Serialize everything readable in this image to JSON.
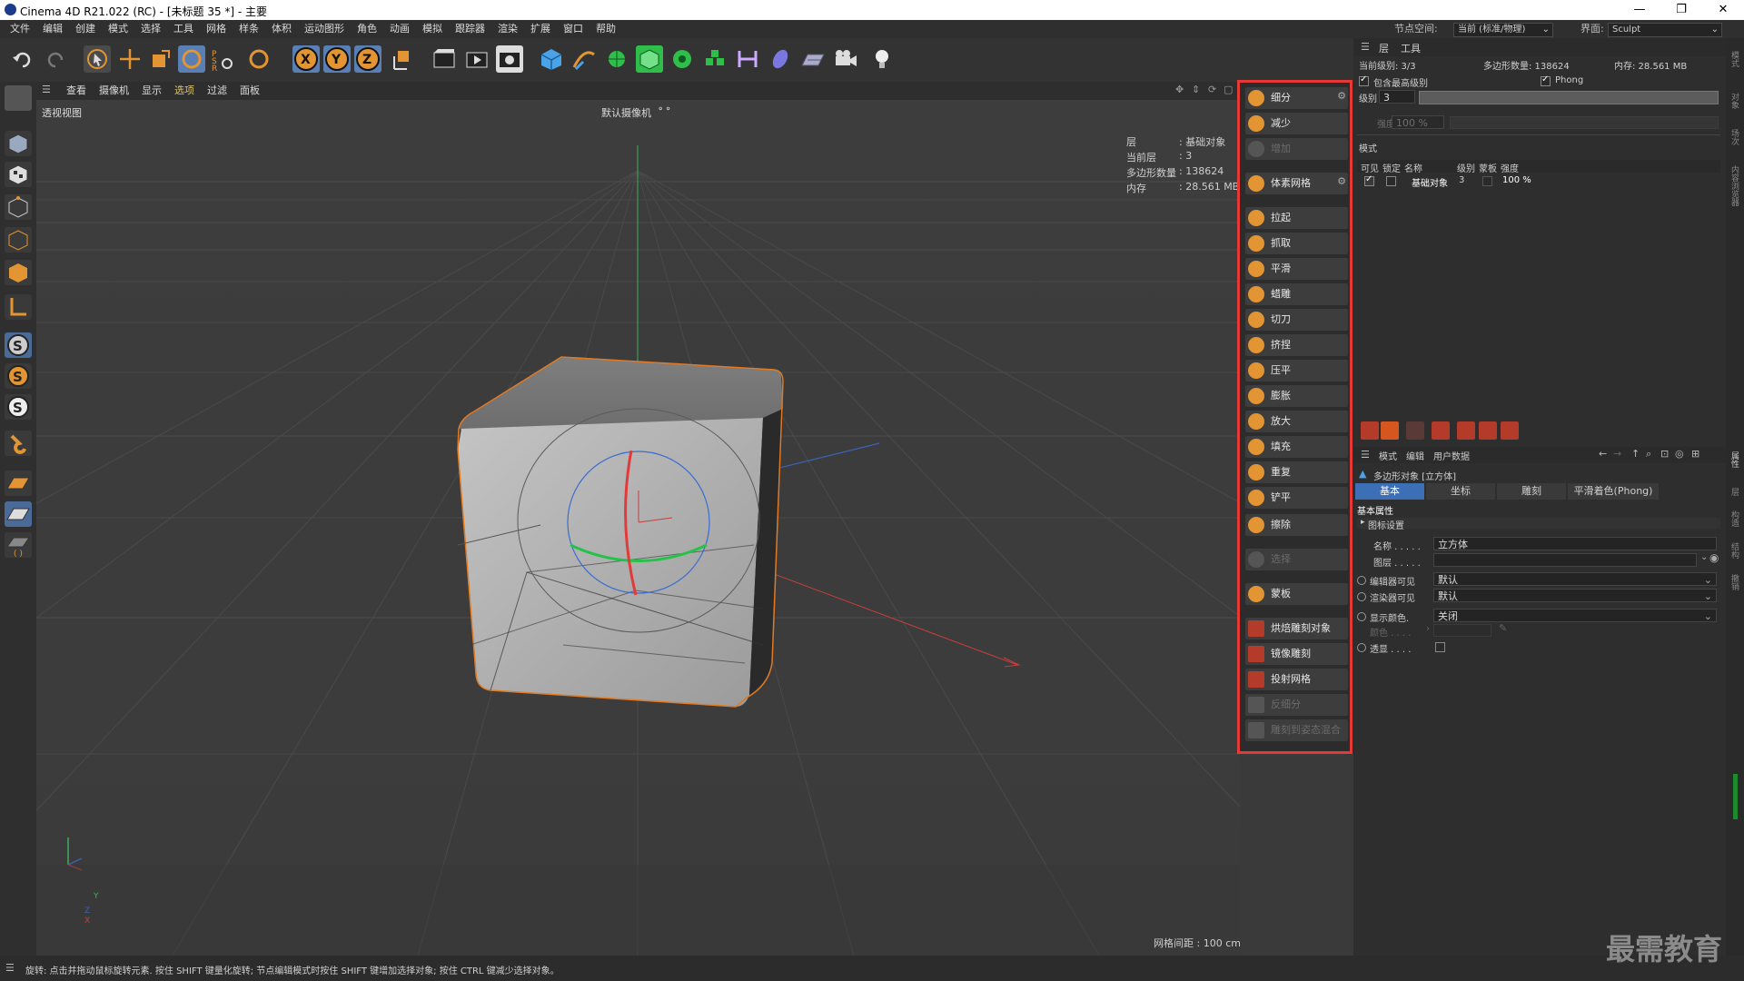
{
  "window": {
    "title": "Cinema 4D R21.022 (RC) - [未标题 35 *] - 主要",
    "controls": [
      "—",
      "❐",
      "✕"
    ]
  },
  "menubar": {
    "items": [
      "文件",
      "编辑",
      "创建",
      "模式",
      "选择",
      "工具",
      "网格",
      "样条",
      "体积",
      "运动图形",
      "角色",
      "动画",
      "模拟",
      "跟踪器",
      "渲染",
      "扩展",
      "窗口",
      "帮助"
    ],
    "node_space_label": "节点空间:",
    "node_space_value": "当前 (标准/物理)",
    "layout_label": "界面:",
    "layout_value": "Sculpt"
  },
  "viewport": {
    "menu": [
      "查看",
      "摄像机",
      "显示",
      "选项",
      "过滤",
      "面板"
    ],
    "view_name": "透视视图",
    "camera_label": "默认摄像机",
    "camera_icon": "camera-icon",
    "hud": {
      "layer_label": "层",
      "layer_value": ": 基础对象",
      "current_level_label": "当前层",
      "current_level_value": ": 3",
      "poly_count_label": "多边形数量",
      "poly_count_value": ": 138624",
      "memory_label": "内存",
      "memory_value": ": 28.561 MB"
    },
    "grid_spacing": "网格间距 : 100 cm",
    "axis_labels": {
      "y": "Y",
      "z": "Z",
      "x": "X"
    }
  },
  "sculpt_palette": {
    "items": [
      {
        "label": "细分",
        "enabled": true,
        "gear": true
      },
      {
        "label": "减少",
        "enabled": true
      },
      {
        "label": "增加",
        "enabled": false
      },
      {
        "label": "体素网格",
        "enabled": true,
        "gear": true
      },
      {
        "label": "拉起",
        "enabled": true
      },
      {
        "label": "抓取",
        "enabled": true
      },
      {
        "label": "平滑",
        "enabled": true
      },
      {
        "label": "蜡雕",
        "enabled": true
      },
      {
        "label": "切刀",
        "enabled": true
      },
      {
        "label": "挤捏",
        "enabled": true
      },
      {
        "label": "压平",
        "enabled": true
      },
      {
        "label": "膨胀",
        "enabled": true
      },
      {
        "label": "放大",
        "enabled": true
      },
      {
        "label": "填充",
        "enabled": true
      },
      {
        "label": "重复",
        "enabled": true
      },
      {
        "label": "铲平",
        "enabled": true
      },
      {
        "label": "擦除",
        "enabled": true
      },
      {
        "label": "选择",
        "enabled": false
      },
      {
        "label": "蒙板",
        "enabled": true
      },
      {
        "label": "烘焙雕刻对象",
        "enabled": true
      },
      {
        "label": "镜像雕刻",
        "enabled": true
      },
      {
        "label": "投射网格",
        "enabled": true
      },
      {
        "label": "反细分",
        "enabled": false
      },
      {
        "label": "雕刻到姿态混合",
        "enabled": false
      }
    ]
  },
  "layers_panel": {
    "tabs": [
      "层",
      "工具"
    ],
    "current_level": "当前级别: 3/3",
    "poly_count": "多边形数量: 138624",
    "memory": "内存: 28.561 MB",
    "include_highest": "包含最高级别",
    "phong": "Phong",
    "level_label": "级别",
    "level_value": "3",
    "strength_label": "强度",
    "strength_value": "100 %",
    "mode_label": "模式",
    "columns": [
      "可见",
      "锁定",
      "名称",
      "级别",
      "蒙板",
      "强度"
    ],
    "rows": [
      {
        "name": "基础对象",
        "level": "3",
        "strength": "100 %"
      }
    ]
  },
  "attributes_panel": {
    "menu": [
      "模式",
      "编辑",
      "用户数据"
    ],
    "object_title": "多边形对象 [立方体]",
    "tabs": [
      "基本",
      "坐标",
      "雕刻",
      "平滑着色(Phong)"
    ],
    "section": "基本属性",
    "subsection": "图标设置",
    "name_label": "名称 . . . . .",
    "name_value": "立方体",
    "layer_label": "图层 . . . . .",
    "editor_visible_label": "编辑器可见",
    "editor_visible_value": "默认",
    "render_visible_label": "渲染器可见",
    "render_visible_value": "默认",
    "display_color_label": "显示颜色.",
    "display_color_value": "关闭",
    "color_label": "颜色 . . . .",
    "xray_label": "透显 . . . ."
  },
  "right_strip_tabs": [
    "模式",
    "对象",
    "场次",
    "内容浏览器",
    "属性",
    "层",
    "构造",
    "结构",
    "撤销"
  ],
  "statusbar": {
    "text": "旋转: 点击并拖动鼠标旋转元素. 按住 SHIFT 键量化旋转; 节点编辑模式时按住 SHIFT 键增加选择对象; 按住 CTRL 键减少选择对象。"
  },
  "watermark": "最需教育",
  "colors": {
    "accent": "#e29532",
    "highlight_outline": "#e53935",
    "active_tab": "#3c6fb5",
    "selection": "#e07a23"
  }
}
